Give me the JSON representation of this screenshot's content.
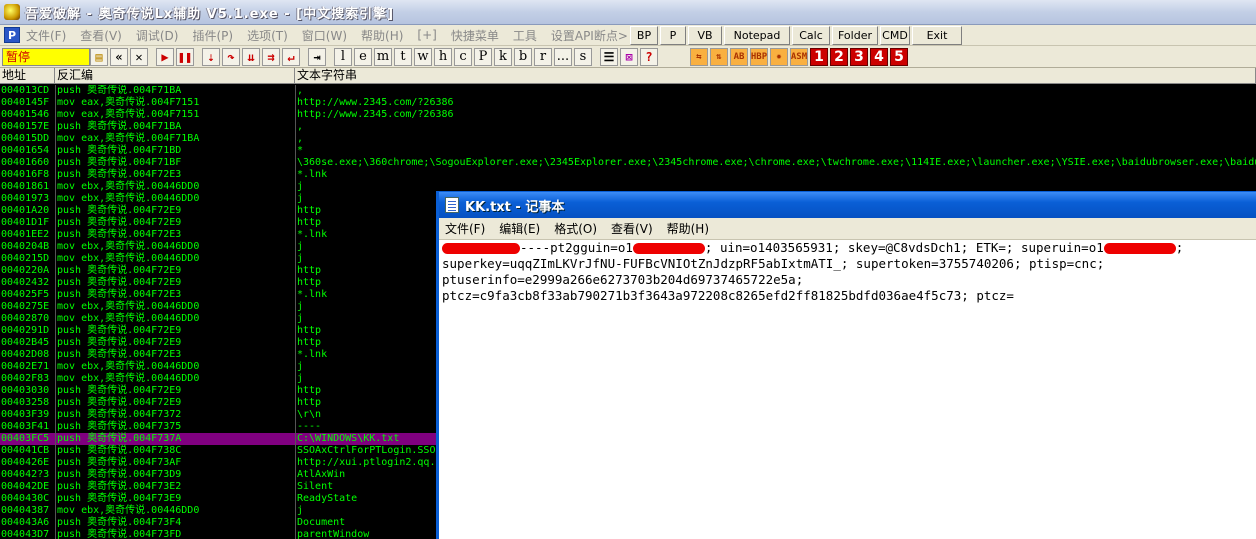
{
  "window": {
    "title": "吾爱破解 - 奥奇传说Lx辅助 V5.1.exe - [中文搜索引擎]"
  },
  "menu": {
    "items": [
      "文件(F)",
      "查看(V)",
      "调试(D)",
      "插件(P)",
      "选项(T)",
      "窗口(W)",
      "帮助(H)",
      "[+]",
      "快捷菜单",
      "工具",
      "设置API断点>"
    ],
    "buttons": [
      "BP",
      "P",
      "VB",
      "Notepad",
      "Calc",
      "Folder",
      "CMD",
      "Exit"
    ]
  },
  "toolbar": {
    "status": "暂停",
    "letters": [
      "l",
      "e",
      "m",
      "t",
      "w",
      "h",
      "c",
      "P",
      "k",
      "b",
      "r",
      "...",
      "s"
    ],
    "numbers": [
      "1",
      "2",
      "3",
      "4",
      "5"
    ],
    "asm_label": "ASM",
    "hbp_label": "HBP"
  },
  "columns": {
    "address": "地址",
    "disasm": "反汇编",
    "string": "文本字符串"
  },
  "rows": [
    {
      "a": "004013CD",
      "d": "push 奥奇传说.004F71BA",
      "s": ","
    },
    {
      "a": "0040145F",
      "d": "mov eax,奥奇传说.004F7151",
      "s": "http://www.2345.com/?26386"
    },
    {
      "a": "00401546",
      "d": "mov eax,奥奇传说.004F7151",
      "s": "http://www.2345.com/?26386"
    },
    {
      "a": "0040157E",
      "d": "push 奥奇传说.004F71BA",
      "s": ","
    },
    {
      "a": "004015DD",
      "d": "mov eax,奥奇传说.004F71BA",
      "s": ","
    },
    {
      "a": "00401654",
      "d": "push 奥奇传说.004F71BD",
      "s": "*"
    },
    {
      "a": "00401660",
      "d": "push 奥奇传说.004F71BF",
      "s": "\\360se.exe;\\360chrome;\\SogouExplorer.exe;\\2345Explorer.exe;\\2345chrome.exe;\\chrome.exe;\\twchrome.exe;\\114IE.exe;\\launcher.exe;\\YSIE.exe;\\baidubrowser.exe;\\baidu"
    },
    {
      "a": "004016F8",
      "d": "push 奥奇传说.004F72E3",
      "s": "*.lnk"
    },
    {
      "a": "00401861",
      "d": "mov ebx,奥奇传说.00446DD0",
      "s": "j"
    },
    {
      "a": "00401973",
      "d": "mov ebx,奥奇传说.00446DD0",
      "s": "j"
    },
    {
      "a": "00401A20",
      "d": "push 奥奇传说.004F72E9",
      "s": "http"
    },
    {
      "a": "00401D1F",
      "d": "push 奥奇传说.004F72E9",
      "s": "http"
    },
    {
      "a": "00401EE2",
      "d": "push 奥奇传说.004F72E3",
      "s": "*.lnk"
    },
    {
      "a": "0040204B",
      "d": "mov ebx,奥奇传说.00446DD0",
      "s": "j"
    },
    {
      "a": "0040215D",
      "d": "mov ebx,奥奇传说.00446DD0",
      "s": "j"
    },
    {
      "a": "0040220A",
      "d": "push 奥奇传说.004F72E9",
      "s": "http"
    },
    {
      "a": "00402432",
      "d": "push 奥奇传说.004F72E9",
      "s": "http"
    },
    {
      "a": "004025F5",
      "d": "push 奥奇传说.004F72E3",
      "s": "*.lnk"
    },
    {
      "a": "0040275E",
      "d": "mov ebx,奥奇传说.00446DD0",
      "s": "j"
    },
    {
      "a": "00402870",
      "d": "mov ebx,奥奇传说.00446DD0",
      "s": "j"
    },
    {
      "a": "0040291D",
      "d": "push 奥奇传说.004F72E9",
      "s": "http"
    },
    {
      "a": "00402B45",
      "d": "push 奥奇传说.004F72E9",
      "s": "http"
    },
    {
      "a": "00402D08",
      "d": "push 奥奇传说.004F72E3",
      "s": "*.lnk"
    },
    {
      "a": "00402E71",
      "d": "mov ebx,奥奇传说.00446DD0",
      "s": "j"
    },
    {
      "a": "00402F83",
      "d": "mov ebx,奥奇传说.00446DD0",
      "s": "j"
    },
    {
      "a": "00403030",
      "d": "push 奥奇传说.004F72E9",
      "s": "http"
    },
    {
      "a": "00403258",
      "d": "push 奥奇传说.004F72E9",
      "s": "http"
    },
    {
      "a": "00403F39",
      "d": "push 奥奇传说.004F7372",
      "s": "\\r\\n"
    },
    {
      "a": "00403F41",
      "d": "push 奥奇传说.004F7375",
      "s": "----"
    },
    {
      "a": "00403FC5",
      "d": "push 奥奇传说.004F737A",
      "s": "C:\\WINDOWS\\KK.txt",
      "selected": true
    },
    {
      "a": "004041CB",
      "d": "push 奥奇传说.004F738C",
      "s": "SSOAxCtrlForPTLogin.SSO"
    },
    {
      "a": "0040426E",
      "d": "push 奥奇传说.004F73AF",
      "s": "http://xui.ptlogin2.qq."
    },
    {
      "a": "004042?3",
      "d": "push 奥奇传说.004F73D9",
      "s": "AtlAxWin"
    },
    {
      "a": "004042DE",
      "d": "push 奥奇传说.004F73E2",
      "s": "Silent"
    },
    {
      "a": "0040430C",
      "d": "push 奥奇传说.004F73E9",
      "s": "ReadyState"
    },
    {
      "a": "00404387",
      "d": "mov ebx,奥奇传说.00446DD0",
      "s": "j"
    },
    {
      "a": "004043A6",
      "d": "push 奥奇传说.004F73F4",
      "s": "Document"
    },
    {
      "a": "004043D7",
      "d": "push 奥奇传说.004F73FD",
      "s": "parentWindow"
    }
  ],
  "notepad": {
    "title": "KK.txt - 记事本",
    "menu": [
      "文件(F)",
      "编辑(E)",
      "格式(O)",
      "查看(V)",
      "帮助(H)"
    ],
    "line1_a": "----pt2gguin=o1",
    "line1_b": "; uin=o1403565931; skey=@C8vdsDch1; ETK=; superuin=o1",
    "line1_c": ";",
    "line2": "superkey=uqqZImLKVrJfNU-FUFBcVNIOtZnJdzpRF5abIxtmATI_; supertoken=3755740206; ptisp=cnc;",
    "line3": "ptuserinfo=e2999a266e6273703b204d69737465722e5a;",
    "line4": "ptcz=c9fa3cb8f33ab790271b3f3643a972208c8265efd2ff81825bdfd036ae4f5c73; ptcz="
  }
}
